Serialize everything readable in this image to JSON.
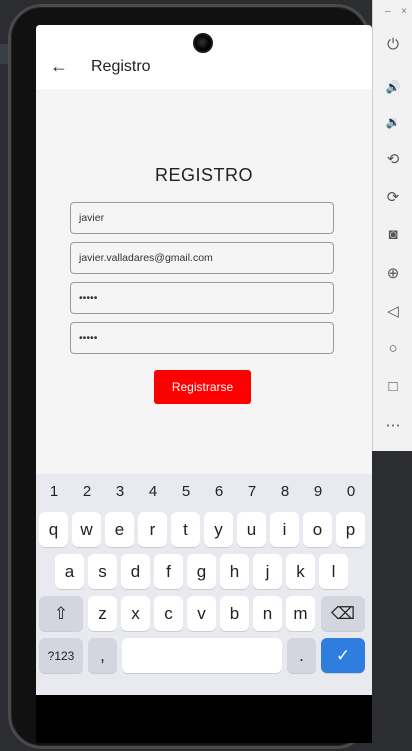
{
  "appbar": {
    "back_icon": "←",
    "title": "Registro"
  },
  "form": {
    "heading": "REGISTRO",
    "name_value": "javier",
    "email_value": "javier.valladares@gmail.com",
    "password_value": "•••••",
    "confirm_password_value": "•••••",
    "submit_label": "Registrarse"
  },
  "keyboard": {
    "numbers": [
      "1",
      "2",
      "3",
      "4",
      "5",
      "6",
      "7",
      "8",
      "9",
      "0"
    ],
    "row1": [
      "q",
      "w",
      "e",
      "r",
      "t",
      "y",
      "u",
      "i",
      "o",
      "p"
    ],
    "row2": [
      "a",
      "s",
      "d",
      "f",
      "g",
      "h",
      "j",
      "k",
      "l"
    ],
    "row3": [
      "z",
      "x",
      "c",
      "v",
      "b",
      "n",
      "m"
    ],
    "shift": "⇧",
    "backspace": "⌫",
    "symbols": "?123",
    "comma": ",",
    "period": ".",
    "enter": "✓"
  },
  "toolbar": {
    "minimize": "–",
    "close": "×",
    "power": "⏻",
    "volume_up": "🔊",
    "volume_down": "🔉",
    "rotate_left": "⟲",
    "rotate_right": "⟳",
    "camera": "◙",
    "zoom": "⊕",
    "back": "◁",
    "home": "○",
    "overview": "□",
    "more": "⋯"
  },
  "colors": {
    "accent": "#ff0000",
    "enter_key": "#2f7ddf"
  }
}
